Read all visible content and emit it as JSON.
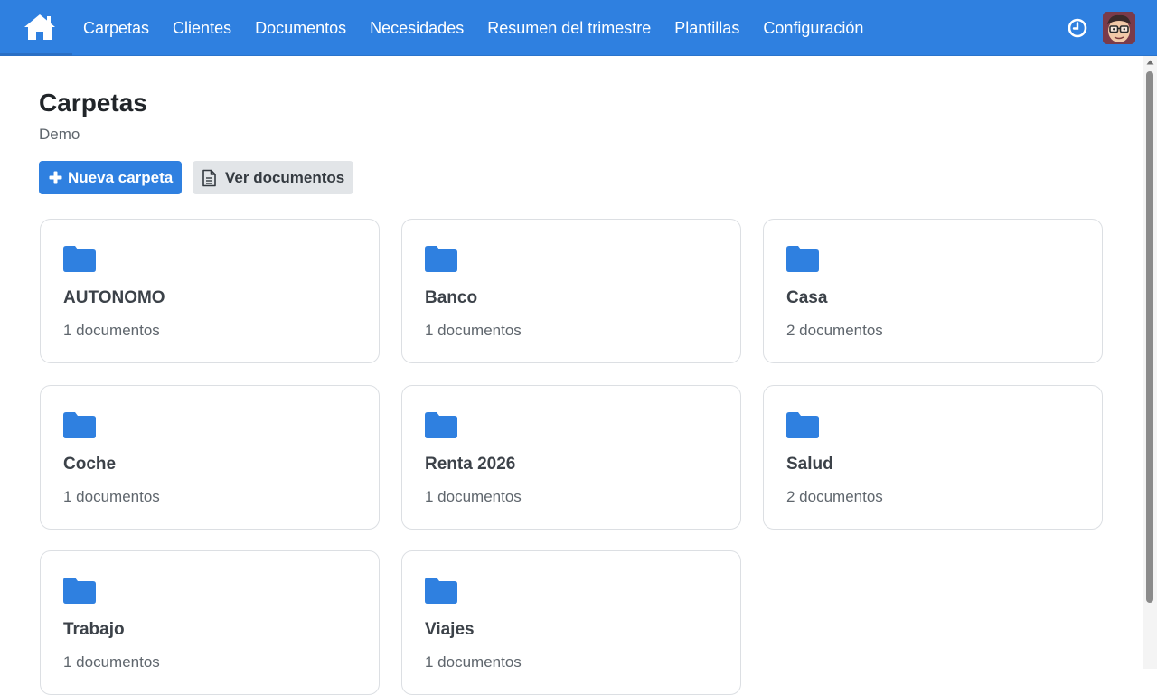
{
  "nav": {
    "home_icon": "home-icon",
    "items": [
      {
        "label": "Carpetas"
      },
      {
        "label": "Clientes"
      },
      {
        "label": "Documentos"
      },
      {
        "label": "Necesidades"
      },
      {
        "label": "Resumen del trimestre"
      },
      {
        "label": "Plantillas"
      },
      {
        "label": "Configuración"
      }
    ],
    "clock_icon": "clock-icon",
    "avatar_icon": "user-avatar"
  },
  "page": {
    "title": "Carpetas",
    "subtitle": "Demo",
    "new_folder_label": "Nueva carpeta",
    "view_documents_label": "Ver documentos"
  },
  "folders": [
    {
      "name": "AUTONOMO",
      "count": "1 documentos"
    },
    {
      "name": "Banco",
      "count": "1 documentos"
    },
    {
      "name": "Casa",
      "count": "2 documentos"
    },
    {
      "name": "Coche",
      "count": "1 documentos"
    },
    {
      "name": "Renta 2026",
      "count": "1 documentos"
    },
    {
      "name": "Salud",
      "count": "2 documentos"
    },
    {
      "name": "Trabajo",
      "count": "1 documentos"
    },
    {
      "name": "Viajes",
      "count": "1 documentos"
    }
  ],
  "colors": {
    "accent": "#2f80e0",
    "folder": "#2f80e0",
    "secondary_button": "#e2e5e8"
  }
}
